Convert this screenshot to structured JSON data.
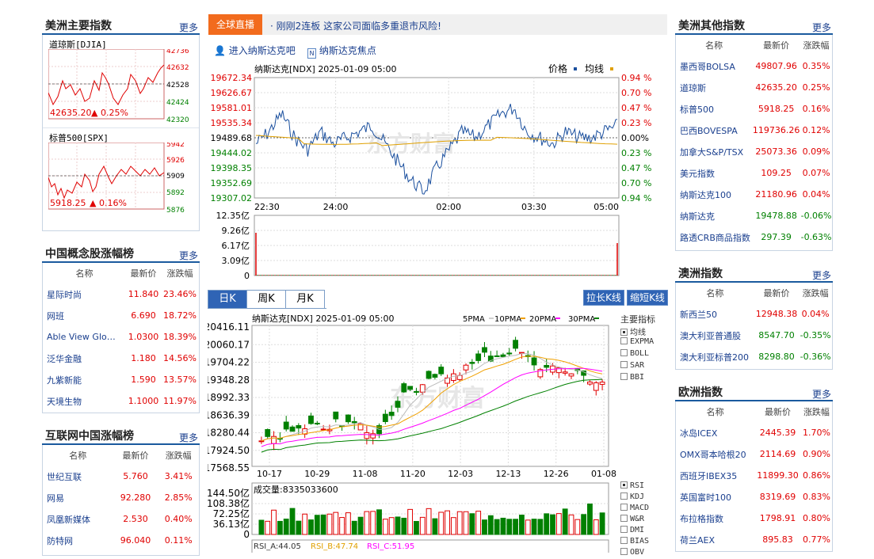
{
  "left": {
    "us_main": {
      "title": "美洲主要指数",
      "more": "更多",
      "dji": {
        "label": "道琼斯[DJIA]",
        "price": "42635.20",
        "pct": "0.25%",
        "axis": [
          "42736",
          "42632",
          "42528",
          "42424",
          "42320"
        ]
      },
      "spx": {
        "label": "标普500[SPX]",
        "price": "5918.25",
        "pct": "0.16%",
        "axis": [
          "5942",
          "5926",
          "5909",
          "5892",
          "5876"
        ]
      }
    },
    "china_concept": {
      "title": "中国概念股涨幅榜",
      "more": "更多",
      "headers": [
        "名称",
        "最新价",
        "涨跌幅"
      ],
      "rows": [
        [
          "星际时尚",
          "11.840",
          "23.46%"
        ],
        [
          "网班",
          "6.690",
          "18.72%"
        ],
        [
          "Able View Glo…",
          "1.0300",
          "18.39%"
        ],
        [
          "泛华金融",
          "1.180",
          "14.56%"
        ],
        [
          "九紫新能",
          "1.590",
          "13.57%"
        ],
        [
          "天境生物",
          "1.1000",
          "11.97%"
        ]
      ]
    },
    "internet_china": {
      "title": "互联网中国涨幅榜",
      "more": "更多",
      "headers": [
        "名称",
        "最新价",
        "涨跌幅"
      ],
      "rows": [
        [
          "世纪互联",
          "5.760",
          "3.41%"
        ],
        [
          "网易",
          "92.280",
          "2.85%"
        ],
        [
          "凤凰新媒体",
          "2.530",
          "0.40%"
        ],
        [
          "防特网",
          "96.040",
          "0.11%"
        ]
      ]
    }
  },
  "center": {
    "live_tag": "全球直播",
    "news": "· 刚刚2连板 这家公司面临多重退市风险!",
    "link_bar": "进入纳斯达克吧",
    "link_focus": "纳斯达克焦点",
    "intraday": {
      "title": "纳斯达克[NDX] 2025-01-09 05:00",
      "legend_price": "价格",
      "legend_avg": "均线",
      "watermark": "东方财富",
      "y_left": [
        "19672.34",
        "19626.67",
        "19581.01",
        "19535.34",
        "19489.68",
        "19444.02",
        "19398.35",
        "19352.69",
        "19307.02"
      ],
      "y_right": [
        "0.94 %",
        "0.70 %",
        "0.47 %",
        "0.23 %",
        "0.00%",
        "0.23 %",
        "0.47 %",
        "0.70 %",
        "0.94 %"
      ],
      "x_labels": [
        "22:30",
        "24:00",
        "02:00",
        "03:30",
        "05:00"
      ],
      "vol_axis": [
        "12.35亿",
        "9.26亿",
        "6.17亿",
        "3.09亿",
        "0"
      ]
    },
    "ktabs": [
      "日K",
      "周K",
      "月K"
    ],
    "btn_stretch": "拉长K线",
    "btn_shrink": "缩短K线",
    "kline": {
      "title": "纳斯达克[NDX] 2025-01-09 05:00",
      "ma_legend": [
        "5PMA",
        "10PMA",
        "20PMA",
        "30PMA"
      ],
      "ma_colors": [
        "#d0d0d0",
        "#f0a000",
        "#ff00ff",
        "#008000"
      ],
      "y_axis": [
        "20416.11",
        "20060.17",
        "19704.22",
        "19348.28",
        "18992.33",
        "18636.39",
        "18280.44",
        "17924.50",
        "17568.55"
      ],
      "x_labels": [
        "10-17",
        "10-29",
        "11-08",
        "11-20",
        "12-03",
        "12-13",
        "12-26",
        "01-08"
      ],
      "main_indicators_title": "主要指标",
      "main_indicators": [
        "均线",
        "EXPMA",
        "BOLL",
        "SAR",
        "BBI"
      ],
      "vol_title": "成交量:8335033600",
      "vol_axis": [
        "144.50亿",
        "108.38亿",
        "72.25亿",
        "36.13亿",
        "0"
      ],
      "sub_indicators": [
        "RSI",
        "KDJ",
        "MACD",
        "W&R",
        "DMI",
        "BIAS",
        "OBV"
      ],
      "rsi_a": "RSI_A:44.05",
      "rsi_b": "RSI_B:47.74",
      "rsi_c": "RSI_C:51.95"
    }
  },
  "right": {
    "us_other": {
      "title": "美洲其他指数",
      "more": "更多",
      "headers": [
        "名称",
        "最新价",
        "涨跌幅"
      ],
      "rows": [
        [
          "墨西哥BOLSA",
          "49807.96",
          "0.35%"
        ],
        [
          "道琼斯",
          "42635.20",
          "0.25%"
        ],
        [
          "标普500",
          "5918.25",
          "0.16%"
        ],
        [
          "巴西BOVESPA",
          "119736.26",
          "0.12%"
        ],
        [
          "加拿大S&P/TSX",
          "25073.36",
          "0.09%"
        ],
        [
          "美元指数",
          "109.25",
          "0.07%"
        ],
        [
          "纳斯达克100",
          "21180.96",
          "0.04%"
        ],
        [
          "纳斯达克",
          "19478.88",
          "-0.06%"
        ],
        [
          "路透CRB商品指数",
          "297.39",
          "-0.63%"
        ]
      ]
    },
    "au": {
      "title": "澳洲指数",
      "more": "更多",
      "headers": [
        "名称",
        "最新价",
        "涨跌幅"
      ],
      "rows": [
        [
          "新西兰50",
          "12948.38",
          "0.04%"
        ],
        [
          "澳大利亚普通股",
          "8547.70",
          "-0.35%"
        ],
        [
          "澳大利亚标普200",
          "8298.80",
          "-0.36%"
        ]
      ]
    },
    "eu": {
      "title": "欧洲指数",
      "more": "更多",
      "headers": [
        "名称",
        "最新价",
        "涨跌幅"
      ],
      "rows": [
        [
          "冰岛ICEX",
          "2445.39",
          "1.70%"
        ],
        [
          "OMX哥本哈根20",
          "2114.69",
          "0.90%"
        ],
        [
          "西班牙IBEX35",
          "11899.30",
          "0.86%"
        ],
        [
          "英国富时100",
          "8319.69",
          "0.83%"
        ],
        [
          "布拉格指数",
          "1798.91",
          "0.80%"
        ],
        [
          "荷兰AEX",
          "895.83",
          "0.77%"
        ]
      ]
    }
  },
  "colors": {
    "up": "#e00000",
    "down": "#008000",
    "accent": "#2f64b5",
    "orange": "#f26b1d"
  }
}
